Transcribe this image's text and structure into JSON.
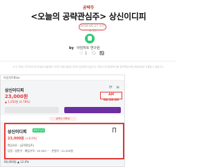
{
  "article": {
    "category": "공략주",
    "title": "<오늘의 공략관심주> 상신이디피",
    "date": "2018.06.27 오전 8:55",
    "author_prefix": "by",
    "author": "아임히트 연구원",
    "likes": "1",
    "description": "※ 이 자료는 투자자의 참고자료로 제공되며, 투자의 최종 결정은 투자자 본인에게 있습니다. 따라서 투자결과에 대한 법적책임소재의 증빙자료로 사용될 수 없습니다."
  },
  "app": {
    "app_name": "아임히트Blue",
    "stock_name": "상신이디피",
    "stock_price": "23,000원",
    "stock_change": "▲ 1,050원 (4.78%)",
    "time": "AM 08:28:30",
    "tab_label": "공략주 리포트"
  },
  "card": {
    "name": "상신이디피",
    "badge": "공략관심주",
    "price": "23,000원",
    "price_change": "(+0.0%)",
    "line1": "편입사유 : [공략관심주]",
    "line2": "당일 : 상한가   · 매입가격 : 25,500 ~   · 손절가 : 22,000원",
    "extra": "60,000원 ▲ 12.0%"
  },
  "colors": {
    "accent": "#e53935",
    "brand": "#2ecc71",
    "purple": "#6b2fa0"
  }
}
